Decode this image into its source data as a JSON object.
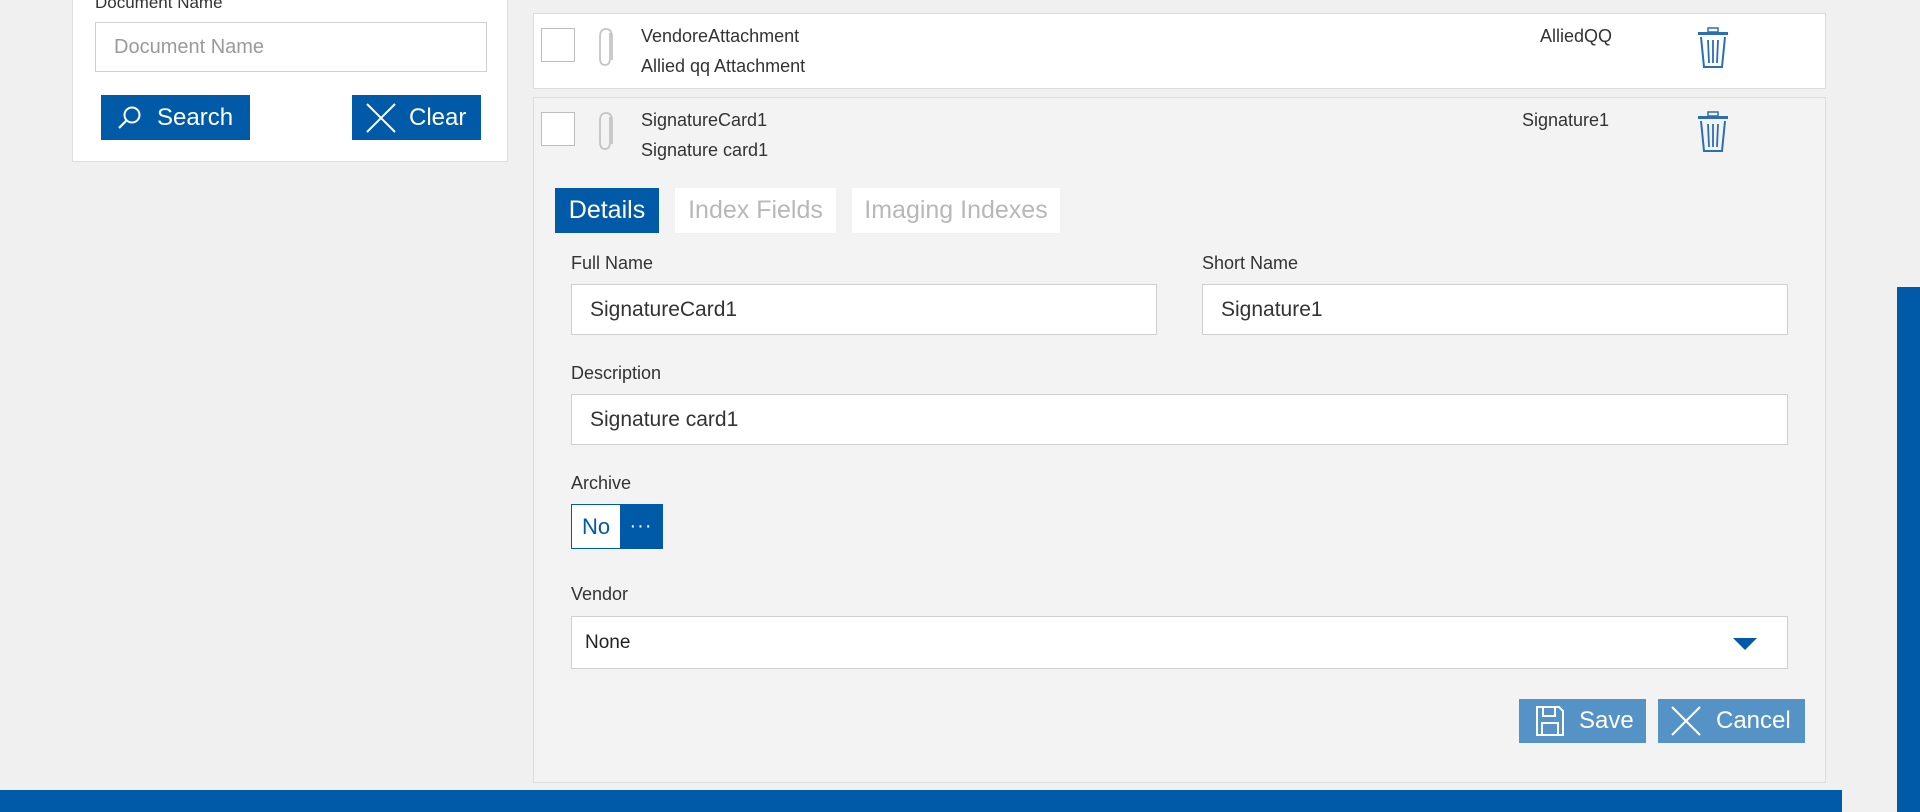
{
  "search_panel": {
    "doc_name_label": "Document Name",
    "doc_name_placeholder": "Document Name",
    "doc_name_value": "",
    "search_label": "Search",
    "clear_label": "Clear"
  },
  "documents": [
    {
      "name": "VendoreAttachment",
      "description": "Allied qq Attachment",
      "short_name": "AlliedQQ"
    },
    {
      "name": "SignatureCard1",
      "description": "Signature card1",
      "short_name": "Signature1"
    }
  ],
  "tabs": [
    {
      "label": "Details",
      "active": true
    },
    {
      "label": "Index Fields",
      "active": false
    },
    {
      "label": "Imaging Indexes",
      "active": false
    }
  ],
  "details": {
    "full_name_label": "Full Name",
    "full_name_value": "SignatureCard1",
    "short_name_label": "Short Name",
    "short_name_value": "Signature1",
    "description_label": "Description",
    "description_value": "Signature card1",
    "archive_label": "Archive",
    "archive_value": "No",
    "archive_more": "···",
    "vendor_label": "Vendor",
    "vendor_value": "None"
  },
  "actions": {
    "save_label": "Save",
    "cancel_label": "Cancel"
  },
  "colors": {
    "primary": "#005aa7",
    "primary_light": "#5593c7",
    "background": "#f0f0f0",
    "icon_muted": "#c4c4c4"
  },
  "icons": [
    "search-icon",
    "close-icon",
    "paperclip-icon",
    "trash-icon",
    "save-icon",
    "chevron-down-icon"
  ]
}
